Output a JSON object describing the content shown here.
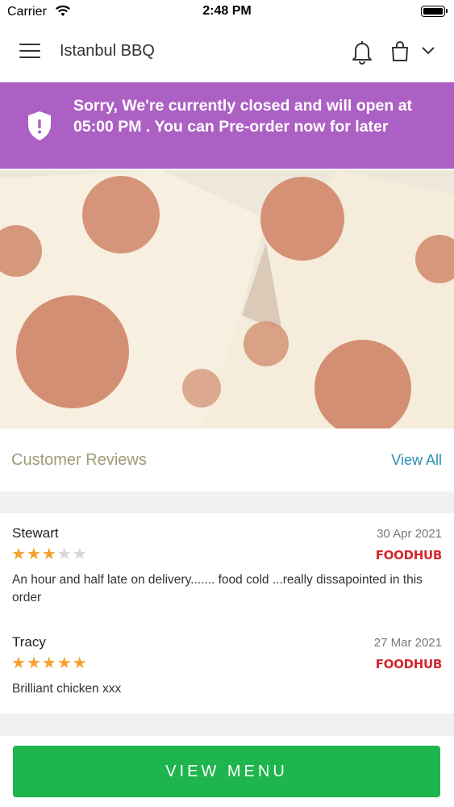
{
  "status_bar": {
    "carrier": "Carrier",
    "time": "2:48 PM"
  },
  "header": {
    "title": "Istanbul BBQ",
    "icons": [
      "menu-icon",
      "bell-icon",
      "bag-icon",
      "chevron-down-icon"
    ]
  },
  "banner": {
    "message": "Sorry, We're currently closed and will open at 05:00 PM . You can Pre-order now for later",
    "icon": "shield-alert-icon",
    "background": "#ac60c4"
  },
  "reviews": {
    "title": "Customer Reviews",
    "view_all": "View All",
    "items": [
      {
        "name": "Stewart",
        "date": "30 Apr 2021",
        "rating": 3,
        "max_rating": 5,
        "source": "FOODHUB",
        "text": "An hour and half late on delivery....... food cold ...really dissapointed in this order"
      },
      {
        "name": "Tracy",
        "date": "27 Mar 2021",
        "rating": 5,
        "max_rating": 5,
        "source": "FOODHUB",
        "text": "Brilliant chicken xxx"
      }
    ]
  },
  "cta": {
    "label": "VIEW MENU",
    "color": "#1fb54d"
  },
  "colors": {
    "star_on": "#f5a22e",
    "star_off": "#d6d6d6",
    "brand": "#d3282f",
    "link": "#2a8fb5"
  }
}
